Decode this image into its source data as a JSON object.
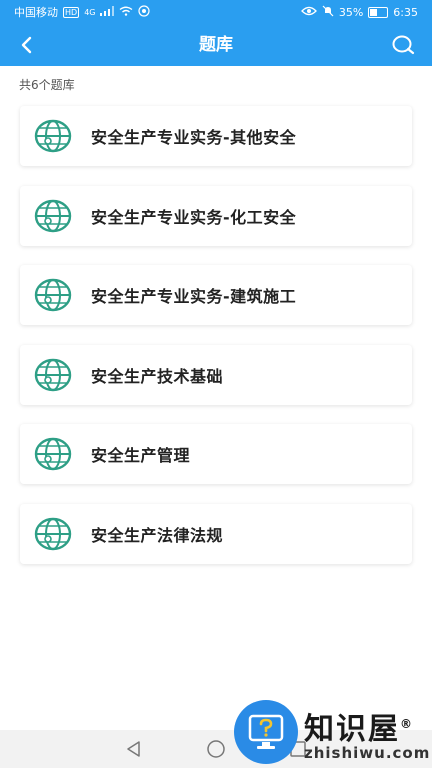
{
  "status_bar": {
    "carrier": "中国移动",
    "hd": "HD",
    "network": "4G",
    "battery": "35%",
    "time": "6:35"
  },
  "header": {
    "title": "题库"
  },
  "count_text": "共6个题库",
  "items": [
    {
      "label": "安全生产专业实务-其他安全",
      "icon": "globe-icon"
    },
    {
      "label": "安全生产专业实务-化工安全",
      "icon": "globe-icon"
    },
    {
      "label": "安全生产专业实务-建筑施工",
      "icon": "globe-icon"
    },
    {
      "label": "安全生产技术基础",
      "icon": "globe-icon"
    },
    {
      "label": "安全生产管理",
      "icon": "globe-icon"
    },
    {
      "label": "安全生产法律法规",
      "icon": "globe-icon"
    }
  ],
  "watermark": {
    "name_cn": "知识屋",
    "registered": "®",
    "domain": "zhishiwu.com"
  },
  "colors": {
    "primary": "#2a9ef0",
    "icon_green": "#2e9f86",
    "text": "#222222"
  }
}
